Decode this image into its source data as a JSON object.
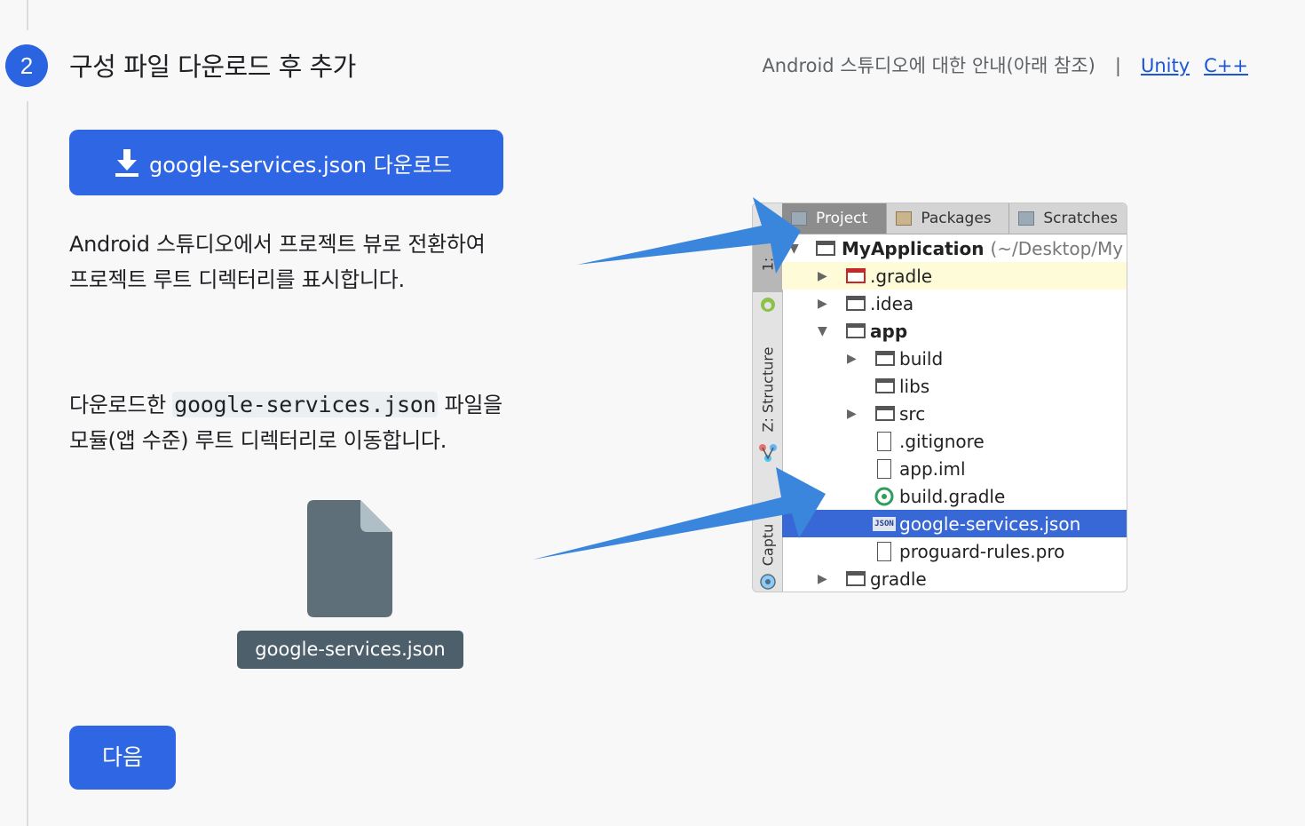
{
  "step": {
    "number": "2",
    "title": "구성 파일 다운로드 후 추가"
  },
  "header": {
    "guide_text": "Android 스튜디오에 대한 안내(아래 참조)",
    "separator": "|",
    "link_unity": "Unity",
    "link_cpp": "C++"
  },
  "download_button": {
    "label": "google-services.json 다운로드",
    "icon": "download-icon"
  },
  "instructions": {
    "p1_line1": "Android 스튜디오에서 프로젝트 뷰로 전환하여",
    "p1_line2": "프로젝트 루트 디렉터리를 표시합니다.",
    "p2_prefix": "다운로드한 ",
    "p2_code": "google-services.json",
    "p2_suffix": " 파일을",
    "p2_line2": "모듈(앱 수준) 루트 디렉터리로 이동합니다."
  },
  "file_tile": {
    "label": "google-services.json",
    "icon": "file-icon"
  },
  "next_button": {
    "label": "다음"
  },
  "ide": {
    "side_tabs": [
      "1: ",
      "Z: Structure",
      "Captu"
    ],
    "tabs": [
      "Project",
      "Packages",
      "Scratches"
    ],
    "tree": {
      "root": "MyApplication",
      "root_path": "(~/Desktop/My",
      "gradle_dir": ".gradle",
      "idea": ".idea",
      "app": "app",
      "build": "build",
      "libs": "libs",
      "src": "src",
      "gitignore": ".gitignore",
      "app_iml": "app.iml",
      "build_gradle": "build.gradle",
      "google_services": "google-services.json",
      "proguard": "proguard-rules.pro",
      "gradle": "gradle"
    },
    "json_badge": "JSON"
  },
  "colors": {
    "accent": "#2f66e3",
    "arrow": "#3a86dc",
    "selection": "#3867d6"
  }
}
